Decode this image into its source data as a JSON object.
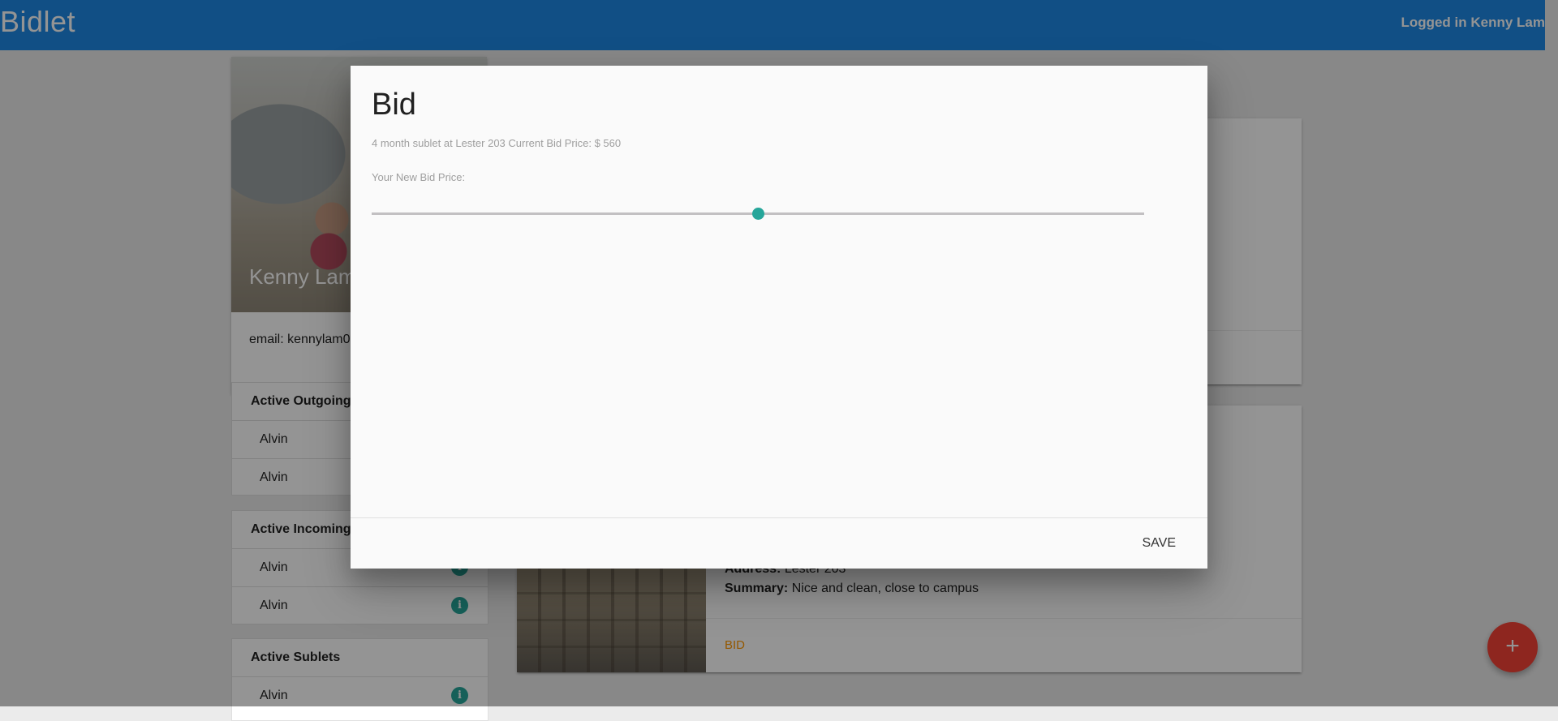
{
  "header": {
    "brand": "Bidlet",
    "user_status": "Logged in Kenny Lam"
  },
  "profile": {
    "name": "Kenny Lam",
    "email": "email: kennylam0"
  },
  "collections": {
    "outgoing": {
      "title": "Active Outgoing",
      "items": [
        {
          "label": "Alvin"
        },
        {
          "label": "Alvin"
        }
      ]
    },
    "incoming": {
      "title": "Active Incoming",
      "items": [
        {
          "label": "Alvin"
        },
        {
          "label": "Alvin"
        }
      ]
    },
    "sublets": {
      "title": "Active Sublets",
      "items": [
        {
          "label": "Alvin"
        }
      ]
    },
    "info_glyph": "i"
  },
  "listing": {
    "address_label": "Address:",
    "address": "Lester 203",
    "summary_label": "Summary:",
    "summary": "Nice and clean, close to campus",
    "bid_label": "BID"
  },
  "fab": {
    "label": "+"
  },
  "modal": {
    "title": "Bid",
    "description": "4 month sublet at Lester 203 Current Bid Price: $ 560",
    "field_label": "Your New Bid Price:",
    "slider_fraction": 0.5,
    "save_label": "SAVE"
  },
  "colors": {
    "header_blue": "#1e88e5",
    "accent_teal": "#26a69a",
    "fab_red": "#f44336",
    "bid_orange": "#ff9800"
  },
  "icons": {
    "info": "info-icon",
    "add": "add-icon"
  }
}
